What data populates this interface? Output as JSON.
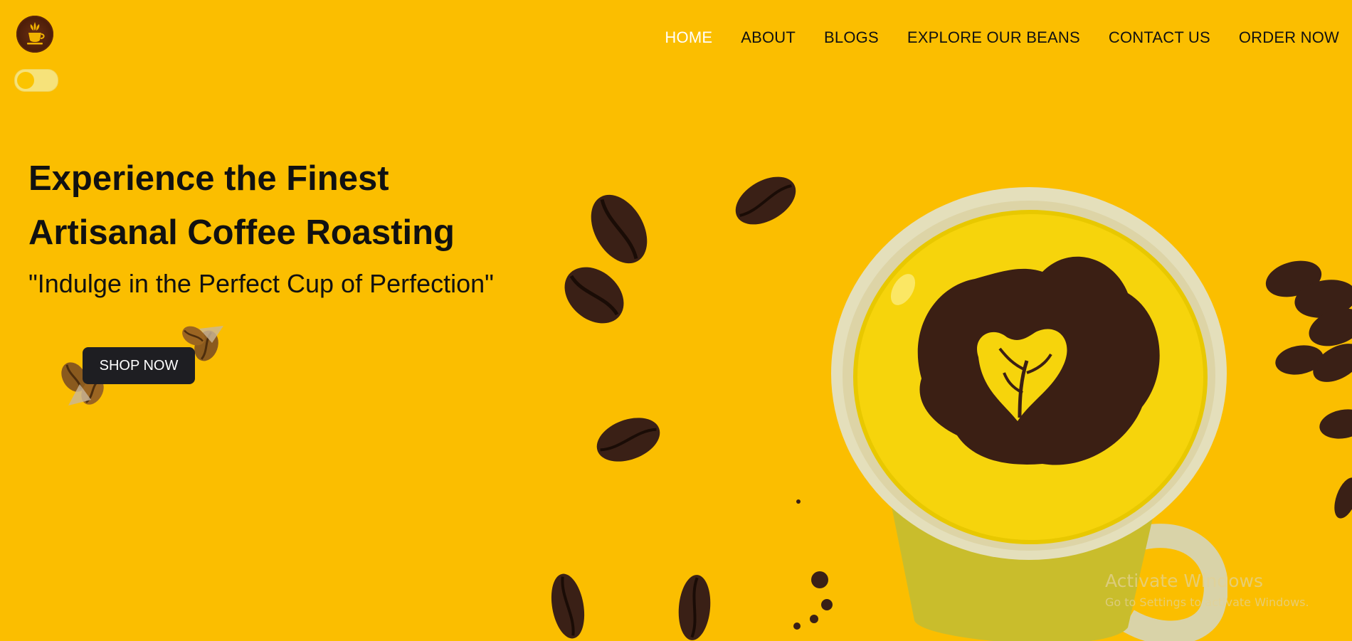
{
  "nav": {
    "items": [
      {
        "label": "HOME",
        "active": true
      },
      {
        "label": "ABOUT",
        "active": false
      },
      {
        "label": "BLOGS",
        "active": false
      },
      {
        "label": "EXPLORE OUR BEANS",
        "active": false
      },
      {
        "label": "CONTACT US",
        "active": false
      },
      {
        "label": "ORDER NOW",
        "active": false
      }
    ]
  },
  "hero": {
    "title_line1": "Experience the Finest",
    "title_line2": "Artisanal Coffee Roasting",
    "subtitle": "\"Indulge in the Perfect Cup of Perfection\"",
    "cta_label": "SHOP NOW"
  },
  "watermark": {
    "line1": "Activate Windows",
    "line2": "Go to Settings to activate Windows."
  },
  "theme": {
    "background": "#fbbe00",
    "text": "#111111",
    "active_nav": "#ffffff",
    "button": "#1e1e22",
    "coffee_dark": "#3a2016"
  },
  "icons": {
    "logo": "coffee-cup-wheat-logo",
    "toggle": "dark-mode-toggle"
  }
}
